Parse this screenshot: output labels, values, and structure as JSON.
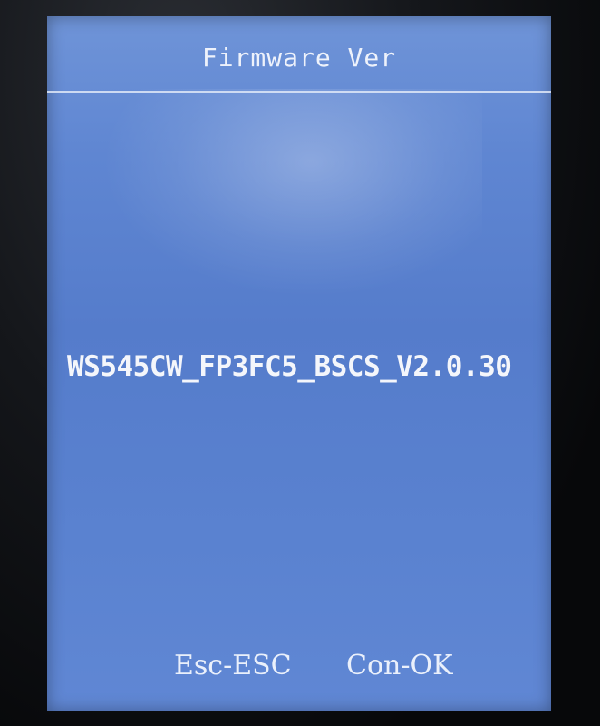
{
  "screen": {
    "title": "Firmware Ver",
    "firmware_version": "WS545CW_FP3FC5_BSCS_V2.0.30"
  },
  "softkeys": {
    "esc_label": "Esc-ESC",
    "ok_label": "Con-OK"
  },
  "colors": {
    "screen_background": "#5a82d0",
    "text": "#f4f6fb",
    "bezel": "#08090c"
  }
}
